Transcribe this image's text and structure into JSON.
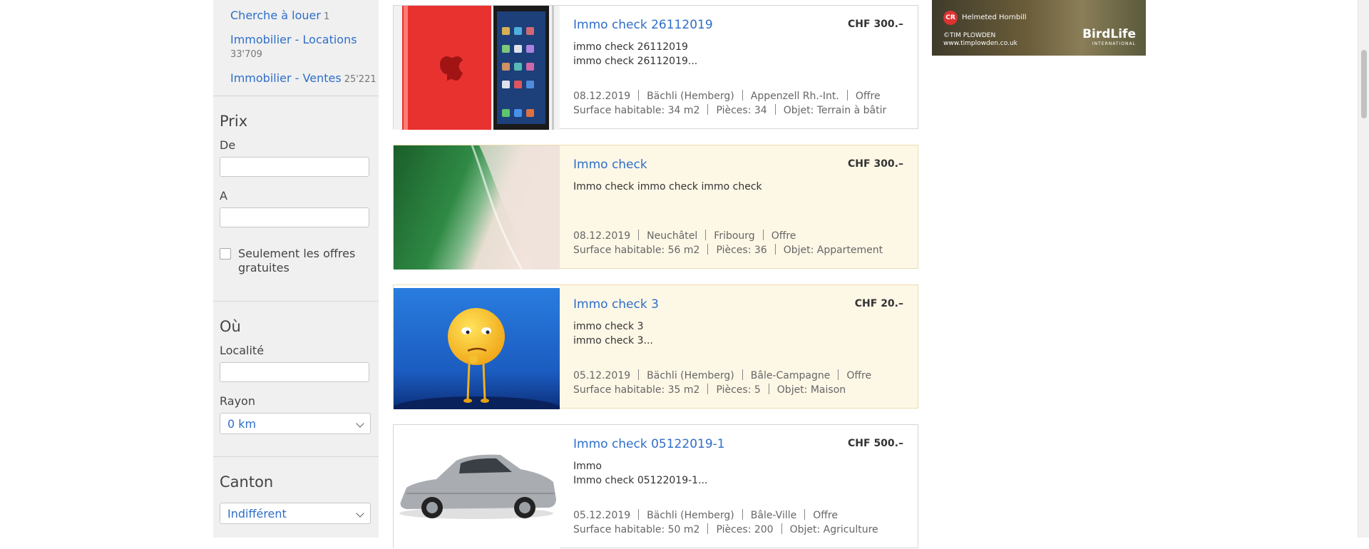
{
  "sidebar": {
    "categories": [
      {
        "label": "Cherche à louer",
        "count": "1"
      },
      {
        "label": "Immobilier - Locations",
        "count": "33'709"
      },
      {
        "label": "Immobilier - Ventes",
        "count": "25'221"
      }
    ],
    "price": {
      "heading": "Prix",
      "from_label": "De",
      "from_value": "",
      "to_label": "A",
      "to_value": "",
      "free_only_label": "Seulement les offres gratuites"
    },
    "where": {
      "heading": "Où",
      "locality_label": "Localité",
      "locality_value": "",
      "radius_label": "Rayon",
      "radius_value": "0 km"
    },
    "canton": {
      "heading": "Canton",
      "value": "Indifférent"
    }
  },
  "listings": [
    {
      "title": "Immo check 26112019",
      "price": "CHF 300.–",
      "description": [
        "immo check 26112019",
        "immo check 26112019..."
      ],
      "date": "08.12.2019",
      "locality": "Bächli (Hemberg)",
      "region": "Appenzell Rh.-Int.",
      "type": "Offre",
      "surface": "Surface habitable: 34 m2",
      "rooms": "Pièces: 34",
      "object": "Objet: Terrain à bâtir",
      "image": "red-tablet-image",
      "highlighted": false
    },
    {
      "title": "Immo check",
      "price": "CHF 300.–",
      "description": [
        "Immo check immo check immo check"
      ],
      "date": "08.12.2019",
      "locality": "Neuchâtel",
      "region": "Fribourg",
      "type": "Offre",
      "surface": "Surface habitable: 56 m2",
      "rooms": "Pièces: 36",
      "object": "Objet: Appartement",
      "image": "green-wave-image",
      "highlighted": true
    },
    {
      "title": "Immo check 3",
      "price": "CHF 20.–",
      "description": [
        "immo check 3",
        "immo check 3..."
      ],
      "date": "05.12.2019",
      "locality": "Bächli (Hemberg)",
      "region": "Bâle-Campagne",
      "type": "Offre",
      "surface": "Surface habitable: 35 m2",
      "rooms": "Pièces: 5",
      "object": "Objet: Maison",
      "image": "emoji-character-image",
      "highlighted": true
    },
    {
      "title": "Immo check 05122019-1",
      "price": "CHF 500.–",
      "description": [
        "Immo",
        "Immo check 05122019-1..."
      ],
      "date": "05.12.2019",
      "locality": "Bächli (Hemberg)",
      "region": "Bâle-Ville",
      "type": "Offre",
      "surface": "Surface habitable: 50 m2",
      "rooms": "Pièces: 200",
      "object": "Objet: Agriculture",
      "image": "silver-car-image",
      "highlighted": false
    }
  ],
  "ad": {
    "logo": "CR",
    "species": "Helmeted Hornbill",
    "credit_line1": "©TIM PLOWDEN",
    "credit_line2": "www.timplowden.co.uk",
    "brand": "BirdLife",
    "brand_sub": "INTERNATIONAL"
  }
}
